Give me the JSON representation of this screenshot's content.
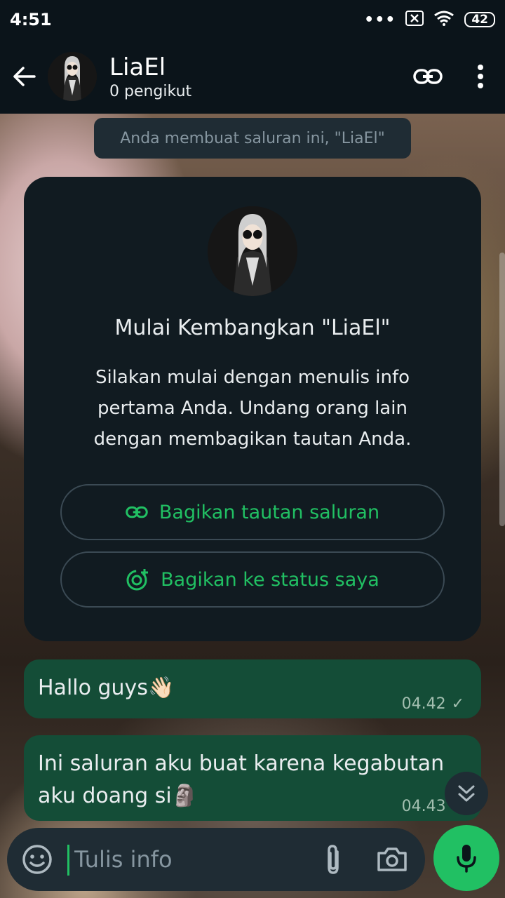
{
  "status_bar": {
    "time": "4:51",
    "more": "•••",
    "battery": "42"
  },
  "header": {
    "title": "LiaEl",
    "subtitle": "0 pengikut"
  },
  "system_message": "Anda membuat saluran ini, \"LiaEl\"",
  "intro_card": {
    "title": "Mulai Kembangkan \"LiaEl\"",
    "body": "Silakan mulai dengan menulis info pertama Anda. Undang orang lain dengan membagikan tautan Anda.",
    "share_link_label": "Bagikan tautan saluran",
    "share_status_label": "Bagikan ke status saya"
  },
  "messages": [
    {
      "text": "Hallo guys👋🏻",
      "time": "04.42",
      "status": "✓"
    },
    {
      "text": "Ini saluran aku buat karena kegabutan aku doang si🗿",
      "time": "04.43",
      "status": "✓"
    }
  ],
  "composer": {
    "placeholder": "Tulis info"
  },
  "colors": {
    "accent": "#21c063",
    "bubble": "#144d37",
    "panel": "#111b21",
    "bar": "#0b141a"
  }
}
